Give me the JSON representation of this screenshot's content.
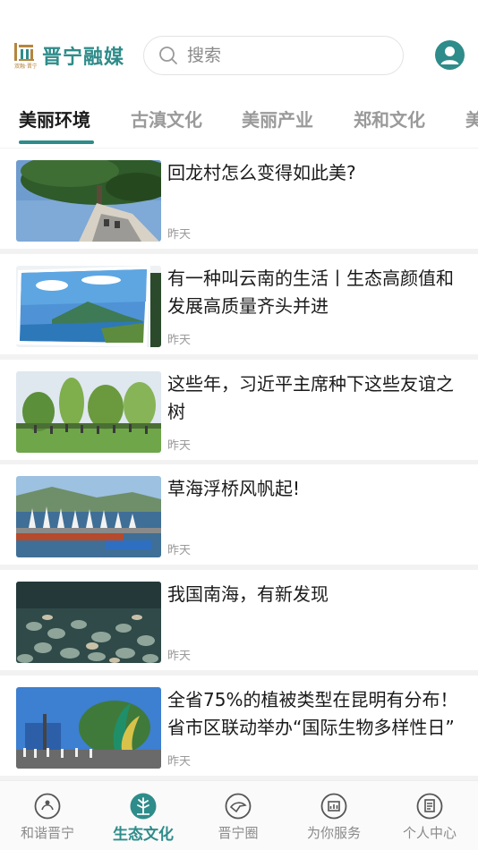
{
  "header": {
    "logo_text": "晋宁融媒",
    "logo_sub": "双融·晋宁",
    "search_placeholder": "搜索",
    "brand_color": "#2e8c8a"
  },
  "tabs": [
    {
      "label": "美丽环境",
      "active": true
    },
    {
      "label": "古滇文化",
      "active": false
    },
    {
      "label": "美丽产业",
      "active": false
    },
    {
      "label": "郑和文化",
      "active": false
    },
    {
      "label": "美",
      "active": false
    }
  ],
  "articles": [
    {
      "title": "回龙村怎么变得如此美?",
      "time": "昨天"
    },
    {
      "title": "有一种叫云南的生活丨生态高颜值和发展高质量齐头并进",
      "time": "昨天"
    },
    {
      "title": "这些年，习近平主席种下这些友谊之树",
      "time": "昨天"
    },
    {
      "title": "草海浮桥风帆起!",
      "time": "昨天"
    },
    {
      "title": "我国南海，有新发现",
      "time": "昨天"
    },
    {
      "title": "全省75%的植被类型在昆明有分布！省市区联动举办“国际生物多样性日”",
      "time": "昨天"
    }
  ],
  "tabbar": [
    {
      "label": "和谐晋宁",
      "icon": "harmony-icon",
      "active": false
    },
    {
      "label": "生态文化",
      "icon": "ecology-icon",
      "active": true
    },
    {
      "label": "晋宁圈",
      "icon": "circle-icon",
      "active": false
    },
    {
      "label": "为你服务",
      "icon": "service-icon",
      "active": false
    },
    {
      "label": "个人中心",
      "icon": "profile-icon",
      "active": false
    }
  ]
}
